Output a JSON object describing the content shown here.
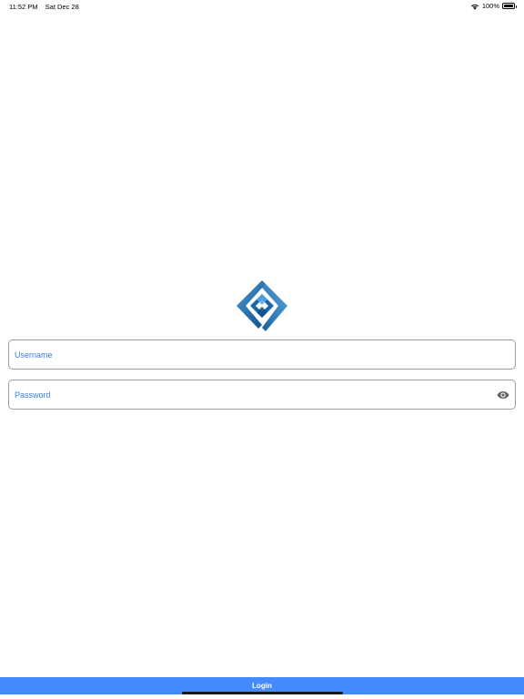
{
  "status_bar": {
    "time": "11:52 PM",
    "date": "Sat Dec 28",
    "battery": "100%",
    "battery_level": 1.0,
    "wifi_icon": "wifi-icon",
    "battery_icon": "battery-icon"
  },
  "logo": {
    "icon": "brand-logo-icon",
    "colors": [
      "#0d4f8b",
      "#1f6fb2",
      "#4a9ad4"
    ]
  },
  "login_form": {
    "username_placeholder": "Username",
    "password_placeholder": "Password",
    "visibility_icon": "eye-icon",
    "placeholder_color": "#3a7fe0"
  },
  "login_button": {
    "label": "Login",
    "background": "#448aff"
  }
}
